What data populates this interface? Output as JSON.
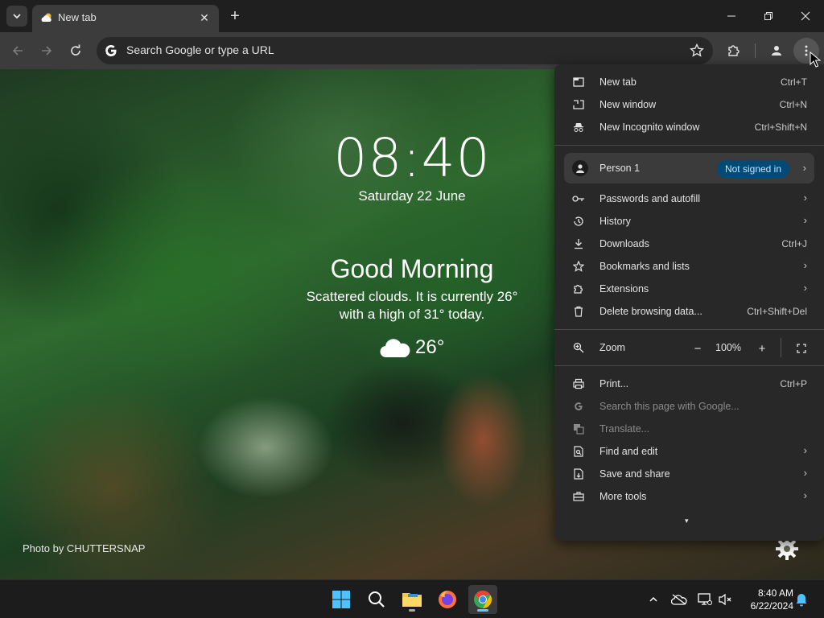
{
  "browser": {
    "tab": {
      "title": "New tab"
    },
    "omnibox": {
      "placeholder": "Search Google or type a URL"
    }
  },
  "newtab": {
    "time": "08:40",
    "date": "Saturday 22 June",
    "greeting": "Good Morning",
    "weather_line1": "Scattered clouds. It is currently 26°",
    "weather_line2": "with a high of 31° today.",
    "temperature": "26°",
    "photo_credit": "Photo by CHUTTERSNAP"
  },
  "menu": {
    "top_items": [
      {
        "label": "New tab",
        "shortcut": "Ctrl+T",
        "icon": "new-tab-icon"
      },
      {
        "label": "New window",
        "shortcut": "Ctrl+N",
        "icon": "new-window-icon"
      },
      {
        "label": "New Incognito window",
        "shortcut": "Ctrl+Shift+N",
        "icon": "incognito-icon"
      }
    ],
    "profile": {
      "name": "Person 1",
      "status": "Not signed in"
    },
    "mid_items": [
      {
        "label": "Passwords and autofill",
        "icon": "key-icon"
      },
      {
        "label": "History",
        "icon": "history-icon"
      },
      {
        "label": "Downloads",
        "shortcut": "Ctrl+J",
        "icon": "download-icon"
      },
      {
        "label": "Bookmarks and lists",
        "icon": "star-icon"
      },
      {
        "label": "Extensions",
        "icon": "puzzle-icon"
      },
      {
        "label": "Delete browsing data...",
        "shortcut": "Ctrl+Shift+Del",
        "icon": "trash-icon"
      }
    ],
    "zoom": {
      "label": "Zoom",
      "value": "100%",
      "minus": "−",
      "plus": "+"
    },
    "bottom_items": [
      {
        "label": "Print...",
        "shortcut": "Ctrl+P",
        "icon": "print-icon"
      },
      {
        "label": "Search this page with Google...",
        "icon": "google-icon",
        "disabled": true
      },
      {
        "label": "Translate...",
        "icon": "translate-icon",
        "disabled": true
      },
      {
        "label": "Find and edit",
        "icon": "find-icon"
      },
      {
        "label": "Save and share",
        "icon": "save-icon"
      },
      {
        "label": "More tools",
        "icon": "toolbox-icon"
      }
    ]
  },
  "taskbar": {
    "time": "8:40 AM",
    "date": "6/22/2024"
  }
}
